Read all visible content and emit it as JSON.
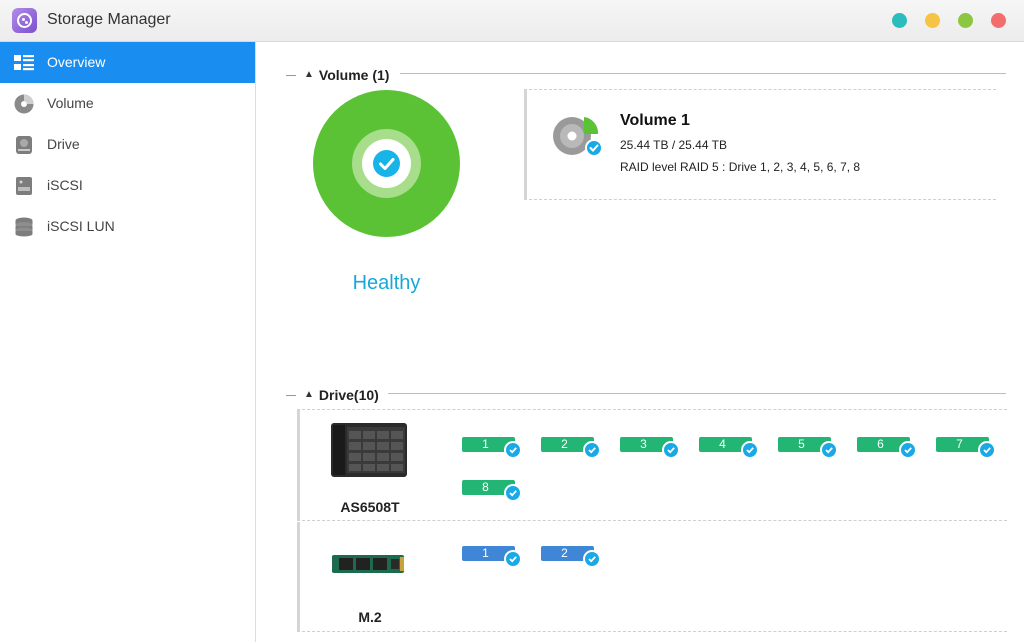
{
  "app": {
    "title": "Storage Manager"
  },
  "window_buttons": [
    {
      "name": "teal",
      "color": "#2bbcbc"
    },
    {
      "name": "yellow",
      "color": "#f6c343"
    },
    {
      "name": "green",
      "color": "#8dc63f"
    },
    {
      "name": "red",
      "color": "#f26d6d"
    }
  ],
  "sidebar": {
    "items": [
      {
        "label": "Overview",
        "icon": "overview-icon",
        "active": true
      },
      {
        "label": "Volume",
        "icon": "volume-icon",
        "active": false
      },
      {
        "label": "Drive",
        "icon": "drive-icon",
        "active": false
      },
      {
        "label": "iSCSI",
        "icon": "iscsi-icon",
        "active": false
      },
      {
        "label": "iSCSI LUN",
        "icon": "iscsi-lun-icon",
        "active": false
      }
    ]
  },
  "volume_section": {
    "title": "Volume (1)",
    "status": "Healthy",
    "volume": {
      "name": "Volume 1",
      "size": "25.44 TB / 25.44 TB",
      "raid": "RAID level RAID 5 : Drive 1, 2, 3, 4, 5, 6, 7, 8"
    }
  },
  "drive_section": {
    "title": "Drive(10)",
    "devices": [
      {
        "name": "AS6508T",
        "drives": [
          "1",
          "2",
          "3",
          "4",
          "5",
          "6",
          "7",
          "8"
        ]
      },
      {
        "name": "M.2",
        "drives": [
          "1",
          "2"
        ]
      }
    ]
  },
  "colors": {
    "accent": "#1a8ef0",
    "healthy_green": "#5bc236",
    "healthy_text": "#1aa7d8",
    "drive_green": "#22b573",
    "drive_blue": "#3f86d6",
    "check_blue": "#1aa9e6"
  }
}
